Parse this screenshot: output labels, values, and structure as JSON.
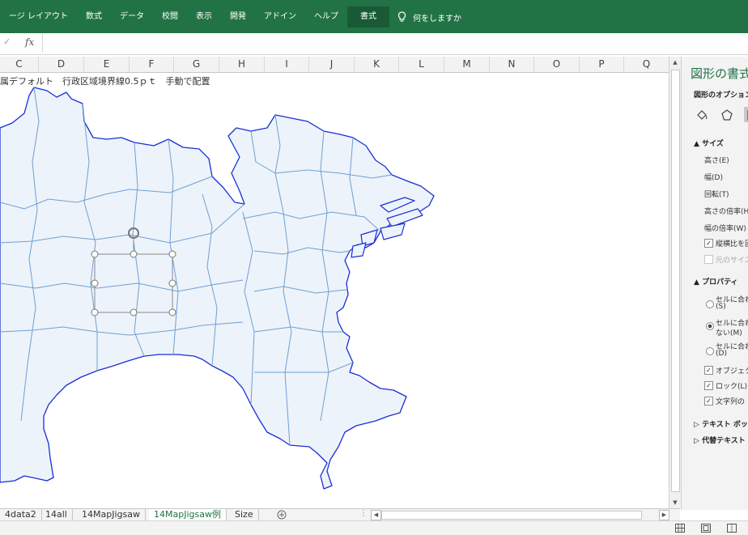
{
  "ribbon": {
    "tabs": [
      "ージ レイアウト",
      "数式",
      "データ",
      "校閲",
      "表示",
      "開発",
      "アドイン",
      "ヘルプ"
    ],
    "active_tab": "書式",
    "tell_me": "何をしますか"
  },
  "formula_bar": {
    "cancel_glyph": "✓",
    "fx": "fx",
    "value": ""
  },
  "columns": [
    "C",
    "D",
    "E",
    "F",
    "G",
    "H",
    "I",
    "J",
    "K",
    "L",
    "M",
    "N",
    "O",
    "P",
    "Q"
  ],
  "cell_text": "属デフォルト　行政区域境界線0.5ｐｔ　手動で配置",
  "format_pane": {
    "title": "図形の書式",
    "options_label": "図形のオプション",
    "size_section": "サイズ",
    "size_rows": [
      "高さ(E)",
      "幅(D)",
      "回転(T)",
      "高さの倍率(H)",
      "幅の倍率(W)"
    ],
    "lock_aspect": "縦横比を固",
    "original_size": "元のサイズ",
    "properties_section": "プロパティ",
    "radio_1": "セルに合わ",
    "radio_1_sub": "(S)",
    "radio_2": "セルに合わ",
    "radio_2_sub": "ない(M)",
    "radio_3": "セルに合わ",
    "radio_3_sub": "(D)",
    "check_1": "オブジェクト",
    "check_2": "ロック(L)",
    "check_3": "文字列の",
    "textbox_section": "テキスト ボック",
    "alt_text_section": "代替テキスト"
  },
  "sheet_tabs": [
    {
      "label": "4data2",
      "active": false
    },
    {
      "label": "14all",
      "active": false
    },
    {
      "label": "14MapJigsaw",
      "active": false
    },
    {
      "label": "14MapJigsaw例",
      "active": true
    },
    {
      "label": "Size",
      "active": false
    }
  ],
  "colors": {
    "accent": "#217346",
    "map_fill": "#edf3fa",
    "coast_line": "#1a2fd6",
    "boundary_line": "#6e9fd4"
  },
  "icons": [
    "lightbulb-icon",
    "check-icon",
    "fx-icon",
    "fill-line-icon",
    "effects-icon",
    "size-properties-icon",
    "add-sheet-icon",
    "scroll-left-icon",
    "scroll-right-icon",
    "normal-view-icon",
    "page-layout-icon",
    "page-break-icon"
  ]
}
